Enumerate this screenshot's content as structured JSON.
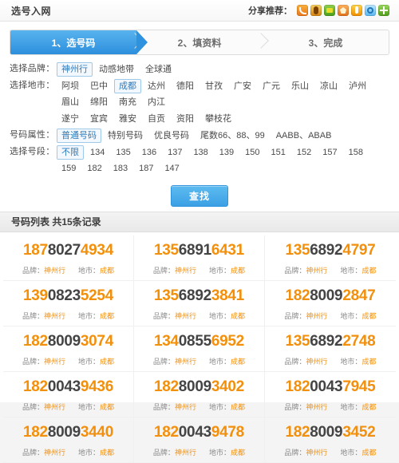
{
  "header": {
    "title": "选号入网",
    "share_label": "分享推荐：",
    "share_icons": [
      {
        "name": "rss-share-icon",
        "class": "sic-rss"
      },
      {
        "name": "tencent-weibo-share-icon",
        "class": "sic-tx"
      },
      {
        "name": "msn-share-icon",
        "class": "sic-ms"
      },
      {
        "name": "baidu-share-icon",
        "class": "sic-pc"
      },
      {
        "name": "qzone-share-icon",
        "class": "sic-qz"
      },
      {
        "name": "qq-share-icon",
        "class": "sic-qq"
      },
      {
        "name": "more-share-icon",
        "class": "sic-plus"
      }
    ]
  },
  "steps": [
    {
      "label": "1、选号码",
      "active": true
    },
    {
      "label": "2、填资料",
      "active": false
    },
    {
      "label": "3、完成",
      "active": false
    }
  ],
  "filters": [
    {
      "name": "brand",
      "label": "选择品牌：",
      "rows": [
        [
          "神州行",
          "动感地带",
          "全球通"
        ]
      ],
      "selected": "神州行"
    },
    {
      "name": "city",
      "label": "选择地市：",
      "rows": [
        [
          "阿坝",
          "巴中",
          "成都",
          "达州",
          "德阳",
          "甘孜",
          "广安",
          "广元",
          "乐山",
          "凉山",
          "泸州",
          "眉山",
          "绵阳",
          "南充",
          "内江"
        ],
        [
          "遂宁",
          "宜宾",
          "雅安",
          "自贡",
          "资阳",
          "攀枝花"
        ]
      ],
      "selected": "成都"
    },
    {
      "name": "number-attribute",
      "label": "号码属性：",
      "rows": [
        [
          "普通号码",
          "特别号码",
          "优良号码",
          "尾数66、88、99",
          "AABB、ABAB"
        ]
      ],
      "selected": "普通号码"
    },
    {
      "name": "number-segment",
      "label": "选择号段：",
      "rows": [
        [
          "不限",
          "134",
          "135",
          "136",
          "137",
          "138",
          "139",
          "150",
          "151",
          "152",
          "157",
          "158",
          "159",
          "182",
          "183",
          "187",
          "147"
        ]
      ],
      "selected": "不限"
    }
  ],
  "search_button": "查找",
  "list": {
    "title": "号码列表 共15条记录",
    "brand_label": "品牌：",
    "city_label": "地市：",
    "numbers": [
      {
        "prefix": "187",
        "middle": "8027",
        "suffix": "4934",
        "brand": "神州行",
        "city": "成都"
      },
      {
        "prefix": "135",
        "middle": "6891",
        "suffix": "6431",
        "brand": "神州行",
        "city": "成都"
      },
      {
        "prefix": "135",
        "middle": "6892",
        "suffix": "4797",
        "brand": "神州行",
        "city": "成都"
      },
      {
        "prefix": "139",
        "middle": "0823",
        "suffix": "5254",
        "brand": "神州行",
        "city": "成都"
      },
      {
        "prefix": "135",
        "middle": "6892",
        "suffix": "3841",
        "brand": "神州行",
        "city": "成都"
      },
      {
        "prefix": "182",
        "middle": "8009",
        "suffix": "2847",
        "brand": "神州行",
        "city": "成都"
      },
      {
        "prefix": "182",
        "middle": "8009",
        "suffix": "3074",
        "brand": "神州行",
        "city": "成都"
      },
      {
        "prefix": "134",
        "middle": "0855",
        "suffix": "6952",
        "brand": "神州行",
        "city": "成都"
      },
      {
        "prefix": "135",
        "middle": "6892",
        "suffix": "2748",
        "brand": "神州行",
        "city": "成都"
      },
      {
        "prefix": "182",
        "middle": "0043",
        "suffix": "9436",
        "brand": "神州行",
        "city": "成都"
      },
      {
        "prefix": "182",
        "middle": "8009",
        "suffix": "3402",
        "brand": "神州行",
        "city": "成都"
      },
      {
        "prefix": "182",
        "middle": "0043",
        "suffix": "7945",
        "brand": "神州行",
        "city": "成都"
      },
      {
        "prefix": "182",
        "middle": "8009",
        "suffix": "3440",
        "brand": "神州行",
        "city": "成都"
      },
      {
        "prefix": "182",
        "middle": "0043",
        "suffix": "9478",
        "brand": "神州行",
        "city": "成都"
      },
      {
        "prefix": "182",
        "middle": "8009",
        "suffix": "3452",
        "brand": "神州行",
        "city": "成都"
      }
    ]
  },
  "colors": {
    "accent_orange": "#f2900d",
    "accent_blue": "#2f92de",
    "dark_digit": "#444444"
  }
}
